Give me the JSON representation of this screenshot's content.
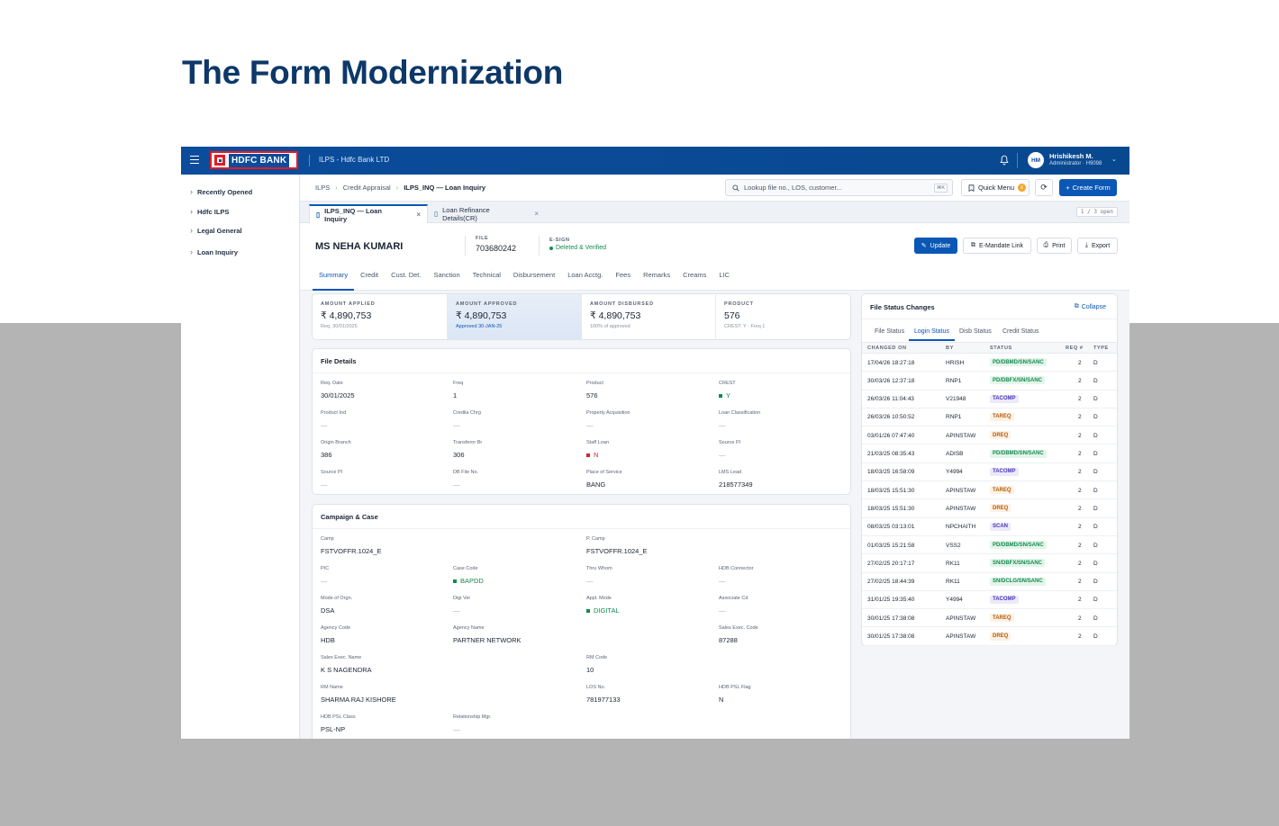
{
  "hero_title": "The Form Modernization",
  "topbar": {
    "logo_text": "HDFC BANK",
    "app_title": "ILPS - Hdfc Bank LTD",
    "user_initials": "HM",
    "user_name": "Hrishikesh M.",
    "user_role": "Administrator · H9098"
  },
  "sidebar": {
    "items": [
      {
        "label": "Recently Opened"
      },
      {
        "label": "Hdfc ILPS"
      },
      {
        "label": "Legal General"
      },
      {
        "label": "Loan Inquiry"
      }
    ]
  },
  "breadcrumb": [
    "ILPS",
    "Credit Appraisal",
    "ILPS_INQ — Loan Inquiry"
  ],
  "search": {
    "placeholder": "Lookup file no., LOS, customer...",
    "shortcut": "⌘K"
  },
  "toolbar": {
    "quick_menu": "Quick Menu",
    "quick_menu_badge": "6",
    "create_form": "Create Form"
  },
  "form_tabs": [
    {
      "label": "ILPS_INQ — Loan Inquiry"
    },
    {
      "label": "Loan Refinance Details(CR)"
    }
  ],
  "open_count": "1 / 3 open",
  "customer": {
    "name": "MS NEHA KUMARI",
    "file_label": "FILE",
    "file_no": "703680242",
    "esign_label": "E-SIGN",
    "esign_value": "Deleted & Verified"
  },
  "actions": {
    "update": "Update",
    "emandate": "E-Mandate Link",
    "print": "Print",
    "export": "Export"
  },
  "subtabs": [
    "Summary",
    "Credit",
    "Cust. Det.",
    "Sanction",
    "Technical",
    "Disbursement",
    "Loan Acctg.",
    "Fees",
    "Remarks",
    "Creams",
    "LIC"
  ],
  "kpis": [
    {
      "label": "AMOUNT APPLIED",
      "value": "₹ 4,890,753",
      "sub": "Req. 30/01/2025"
    },
    {
      "label": "AMOUNT APPROVED",
      "value": "₹ 4,890,753",
      "sub": "Approved 30-JAN-25"
    },
    {
      "label": "AMOUNT DISBURSED",
      "value": "₹ 4,890,753",
      "sub": "100% of approved"
    },
    {
      "label": "PRODUCT",
      "value": "576",
      "sub": "CREST: Y · Freq 1"
    }
  ],
  "file_details": {
    "title": "File Details",
    "fields": [
      {
        "label": "Req. Date",
        "value": "30/01/2025"
      },
      {
        "label": "Freq",
        "value": "1"
      },
      {
        "label": "Product",
        "value": "576"
      },
      {
        "label": "CREST",
        "value": "Y"
      },
      {
        "label": "Product Ind",
        "value": "—"
      },
      {
        "label": "Credila Chrg",
        "value": "—"
      },
      {
        "label": "Property Acquisition",
        "value": "—"
      },
      {
        "label": "Loan Classification",
        "value": "—"
      },
      {
        "label": "Origin Branch",
        "value": "386"
      },
      {
        "label": "Transferor Br",
        "value": "306"
      },
      {
        "label": "Staff Loan",
        "value": "N"
      },
      {
        "label": "Source PI",
        "value": "—"
      },
      {
        "label": "Source PI",
        "value": "—"
      },
      {
        "label": "DB File No.",
        "value": "—"
      },
      {
        "label": "Place of Service",
        "value": "BANG"
      },
      {
        "label": "LMS Lead",
        "value": "218577349"
      }
    ]
  },
  "campaign": {
    "title": "Campaign & Case",
    "fields": [
      {
        "label": "Camp",
        "value": "FSTVOFFR.1024_E"
      },
      {
        "label": "P. Camp",
        "value": "FSTVOFFR.1024_E"
      },
      {
        "label": "PIC",
        "value": "—"
      },
      {
        "label": "Case Code",
        "value": "BAPDD"
      },
      {
        "label": "Thru Whom",
        "value": "—"
      },
      {
        "label": "HDB Connector",
        "value": "—"
      },
      {
        "label": "Mode of Orgn.",
        "value": "DSA"
      },
      {
        "label": "Digi Ver",
        "value": "—"
      },
      {
        "label": "Appl. Mode",
        "value": "DIGITAL"
      },
      {
        "label": "Associate Cd",
        "value": "—"
      },
      {
        "label": "Agency Code",
        "value": "HDB"
      },
      {
        "label": "Agency Name",
        "value": "PARTNER NETWORK"
      },
      {
        "label": "Sales Exec. Code",
        "value": "87288"
      },
      {
        "label": "Sales Exec. Name",
        "value": "K S NAGENDRA"
      },
      {
        "label": "RM Code",
        "value": "10"
      },
      {
        "label": "RM Name",
        "value": "SHARMA RAJ KISHORE"
      },
      {
        "label": "LOS No.",
        "value": "781977133"
      },
      {
        "label": "HDB PSL Flag",
        "value": "N"
      },
      {
        "label": "HDB PSL Class",
        "value": "PSL-NP"
      },
      {
        "label": "Relationship Mgr.",
        "value": "—"
      }
    ]
  },
  "status_panel": {
    "title": "File Status Changes",
    "collapse": "Collapse",
    "tabs": [
      "File Status",
      "Login Status",
      "Disb Status",
      "Credit Status"
    ],
    "columns": [
      "CHANGED ON",
      "BY",
      "STATUS",
      "REQ #",
      "TYPE"
    ],
    "rows": [
      {
        "on": "17/04/26 18:27:18",
        "by": "HRISH",
        "status": "PD/DBMD/SN/SANC",
        "req": "2",
        "type": "D"
      },
      {
        "on": "30/03/26 12:37:18",
        "by": "RNP1",
        "status": "PD/DBFX/SN/SANC",
        "req": "2",
        "type": "D"
      },
      {
        "on": "26/03/26 11:04:43",
        "by": "V21948",
        "status": "TACOMP",
        "req": "2",
        "type": "D"
      },
      {
        "on": "26/03/26 10:50:52",
        "by": "RNP1",
        "status": "TAREQ",
        "req": "2",
        "type": "D"
      },
      {
        "on": "03/01/26 07:47:40",
        "by": "APINSTAW",
        "status": "DREQ",
        "req": "2",
        "type": "D"
      },
      {
        "on": "21/03/25 08:35:43",
        "by": "ADISB",
        "status": "PD/DBMD/SN/SANC",
        "req": "2",
        "type": "D"
      },
      {
        "on": "18/03/25 16:58:09",
        "by": "Y4994",
        "status": "TACOMP",
        "req": "2",
        "type": "D"
      },
      {
        "on": "18/03/25 15:51:30",
        "by": "APINSTAW",
        "status": "TAREQ",
        "req": "2",
        "type": "D"
      },
      {
        "on": "18/03/25 15:51:30",
        "by": "APINSTAW",
        "status": "DREQ",
        "req": "2",
        "type": "D"
      },
      {
        "on": "08/03/25 03:13:01",
        "by": "NPCHAITH",
        "status": "SCAN",
        "req": "2",
        "type": "D"
      },
      {
        "on": "01/03/25 15:21:58",
        "by": "VSS2",
        "status": "PD/DBMD/SN/SANC",
        "req": "2",
        "type": "D"
      },
      {
        "on": "27/02/25 20:17:17",
        "by": "RK11",
        "status": "SN/DBFX/SN/SANC",
        "req": "2",
        "type": "D"
      },
      {
        "on": "27/02/25 18:44:39",
        "by": "RK11",
        "status": "SN/DCLG/SN/SANC",
        "req": "2",
        "type": "D"
      },
      {
        "on": "31/01/25 19:35:40",
        "by": "Y4994",
        "status": "TACOMP",
        "req": "2",
        "type": "D"
      },
      {
        "on": "30/01/25 17:38:08",
        "by": "APINSTAW",
        "status": "TAREQ",
        "req": "2",
        "type": "D"
      },
      {
        "on": "30/01/25 17:38:08",
        "by": "APINSTAW",
        "status": "DREQ",
        "req": "2",
        "type": "D"
      }
    ]
  },
  "colors": {
    "brand": "#0b4c9c",
    "accent": "#0b57b5",
    "green": "#138a4f",
    "red": "#d0262d"
  }
}
